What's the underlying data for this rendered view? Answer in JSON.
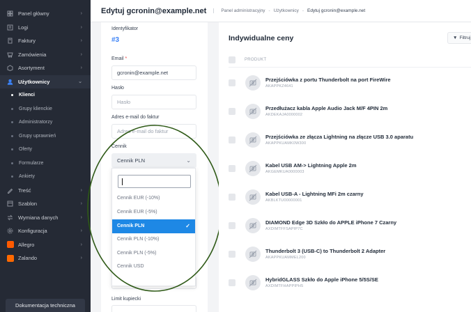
{
  "sidebar": {
    "items": [
      {
        "label": "Panel główny",
        "icon": "dashboard-icon"
      },
      {
        "label": "Logi",
        "icon": "log-icon"
      },
      {
        "label": "Faktury",
        "icon": "invoice-icon"
      },
      {
        "label": "Zamówienia",
        "icon": "orders-icon"
      },
      {
        "label": "Asortyment",
        "icon": "assortment-icon"
      },
      {
        "label": "Użytkownicy",
        "icon": "users-icon"
      }
    ],
    "sub_items": [
      "Klienci",
      "Grupy klienckie",
      "Administratorzy",
      "Grupy uprawnień",
      "Oferty",
      "Formularze",
      "Ankiety"
    ],
    "items_after": [
      {
        "label": "Treść",
        "icon": "content-icon"
      },
      {
        "label": "Szablon",
        "icon": "template-icon"
      },
      {
        "label": "Wymiana danych",
        "icon": "data-exchange-icon"
      },
      {
        "label": "Konfiguracja",
        "icon": "settings-icon"
      },
      {
        "label": "Allegro",
        "icon": "allegro-icon"
      },
      {
        "label": "Zalando",
        "icon": "zalando-icon"
      }
    ],
    "doc_button": "Dokumentacja techniczna",
    "colors": {
      "allegro": "#ff5a00",
      "zalando": "#ff6900",
      "accent": "#3b82f6"
    }
  },
  "header": {
    "title": "Edytuj gcronin@example.net",
    "breadcrumb": [
      "Panel administracyjny",
      "Użytkownicy",
      "Edytuj gcronin@example.net"
    ]
  },
  "form": {
    "id_label": "Identyfikator",
    "id_value": "#3",
    "email_label": "Email",
    "email_required": "*",
    "email_value": "gcronin@example.net",
    "password_label": "Hasło",
    "password_placeholder": "Hasło",
    "invoice_email_label": "Adres e-mail do faktur",
    "invoice_email_placeholder": "Adres e-mail do faktur",
    "pricelist_label": "Cennik",
    "pricelist_value": "Cennik PLN",
    "limit_label": "Limit kupiecki"
  },
  "dropdown": {
    "options": [
      "Cennik EUR (-10%)",
      "Cennik EUR (-5%)",
      "Cennik PLN",
      "Cennik PLN (-10%)",
      "Cennik PLN (-5%)",
      "Cennik USD"
    ],
    "selected_index": 2,
    "selected_color": "#1e88e5"
  },
  "prices": {
    "title": "Indywidualne ceny",
    "filter_label": "Filtruj",
    "column_product": "PRODUKT",
    "products": [
      {
        "name": "Przejściówka z portu Thunderbolt na port FireWire",
        "sku": "AKAPPKZ4641"
      },
      {
        "name": "Przedłużacz kabla Apple Audio Jack M/F 4PIN 2m",
        "sku": "AKDEKAJA0000002"
      },
      {
        "name": "Przejściówka ze złącza Lightning na złącze USB 3.0 aparatu",
        "sku": "AKAPPKUAMK0W300"
      },
      {
        "name": "Kabel USB AM-> Lightning Apple 2m",
        "sku": "AKGEMKUA0000003"
      },
      {
        "name": "Kabel USB-A - Lightning MFi 2m czarny",
        "sku": "AKBLKTU00000001"
      },
      {
        "name": "DIAMOND Edge 3D Szkło do APPLE iPhone 7 Czarny",
        "sku": "AXDIMTFFSAPIP7C"
      },
      {
        "name": "Thunderbolt 3 (USB-C) to Thunderbolt 2 Adapter",
        "sku": "AKAPPKUAMMEL200"
      },
      {
        "name": "HybridGLASS Szkło do Apple iPhone 5/5S/SE",
        "sku": "AXDIMTFHAPPIPH5"
      }
    ]
  },
  "annotation": {
    "color": "#2f5a17"
  }
}
